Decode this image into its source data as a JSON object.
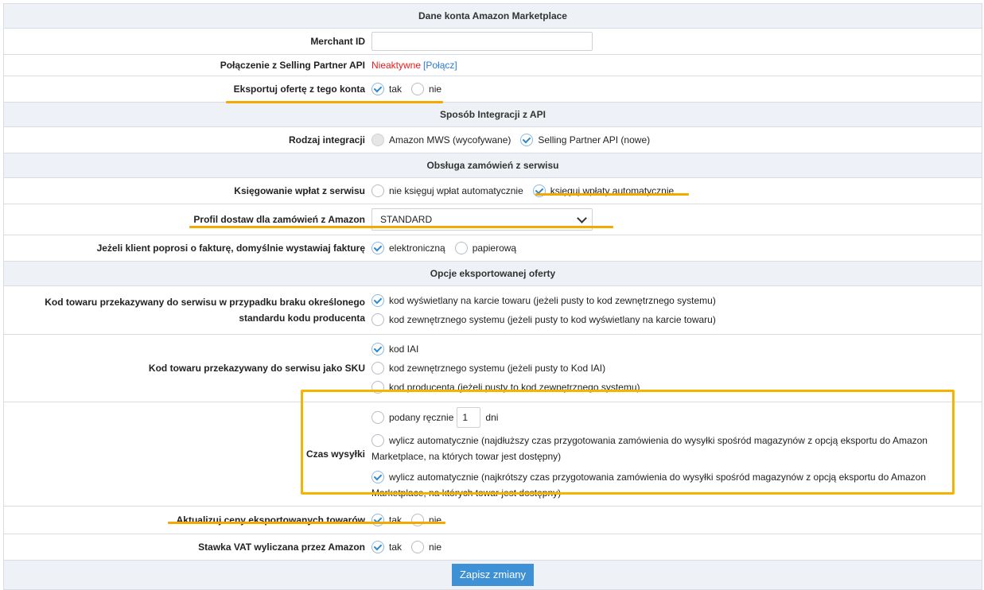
{
  "sections": {
    "account": "Dane konta Amazon Marketplace",
    "api": "Sposób Integracji z API",
    "orders": "Obsługa zamówień z serwisu",
    "export": "Opcje eksportowanej oferty"
  },
  "merchant": {
    "label": "Merchant ID",
    "value": ""
  },
  "spapi": {
    "label": "Połączenie z Selling Partner API",
    "status": "Nieaktywne",
    "link": "[Połącz]"
  },
  "export_offer": {
    "label": "Eksportuj ofertę z tego konta",
    "yes": "tak",
    "no": "nie"
  },
  "integration": {
    "label": "Rodzaj integracji",
    "mws": "Amazon MWS (wycofywane)",
    "sp": "Selling Partner API (nowe)"
  },
  "payments": {
    "label": "Księgowanie wpłat z serwisu",
    "manual": "nie księguj wpłat automatycznie",
    "auto": "księguj wpłaty automatycznie"
  },
  "delivery_profile": {
    "label": "Profil dostaw dla zamówień z Amazon",
    "selected": "STANDARD"
  },
  "invoice": {
    "label": "Jeżeli klient poprosi o fakturę, domyślnie wystawiaj fakturę",
    "electronic": "elektroniczną",
    "paper": "papierową"
  },
  "product_code": {
    "label": "Kod towaru przekazywany do serwisu w przypadku braku określonego standardu kodu producenta",
    "opt1": "kod wyświetlany na karcie towaru (jeżeli pusty to kod zewnętrznego systemu)",
    "opt2": "kod zewnętrznego systemu (jeżeli pusty to kod wyświetlany na karcie towaru)"
  },
  "sku": {
    "label": "Kod towaru przekazywany do serwisu jako SKU",
    "opt1": "kod IAI",
    "opt2": "kod zewnętrznego systemu (jeżeli pusty to Kod IAI)",
    "opt3": "kod producenta (jeżeli pusty to kod zewnętrznego systemu)"
  },
  "shipping_time": {
    "label": "Czas wysyłki",
    "manual": "podany ręcznie",
    "manual_value": "1",
    "days": "dni",
    "longest": "wylicz automatycznie (najdłuższy czas przygotowania zamówienia do wysyłki spośród magazynów z opcją eksportu do Amazon Marketplace, na których towar jest dostępny)",
    "shortest": "wylicz automatycznie (najkrótszy czas przygotowania zamówienia do wysyłki spośród magazynów z opcją eksportu do Amazon Marketplace, na których towar jest dostępny)"
  },
  "update_prices": {
    "label": "Aktualizuj ceny eksportowanych towarów",
    "yes": "tak",
    "no": "nie"
  },
  "vat": {
    "label": "Stawka VAT wyliczana przez Amazon",
    "yes": "tak",
    "no": "nie"
  },
  "save_button": "Zapisz zmiany",
  "colors": {
    "highlight": "#f5a800",
    "accent": "#3d91d4",
    "inactive": "#e31c1c"
  }
}
